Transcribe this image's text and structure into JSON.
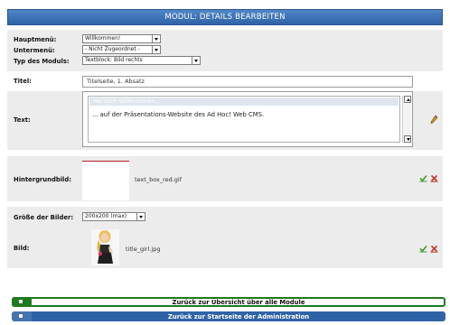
{
  "header": {
    "title": "MODUL: DETAILS BEARBEITEN"
  },
  "form": {
    "hauptmenu": {
      "label": "Hauptmenü:",
      "value": "Willkommen!"
    },
    "untermenu": {
      "label": "Untermenü:",
      "value": "- Nicht Zugeordnet -"
    },
    "typ": {
      "label": "Typ des Moduls:",
      "value": "Textblock: Bild rechts"
    },
    "titel": {
      "label": "Titel:",
      "value": "Titelseite, 1. Absatz"
    },
    "text": {
      "label": "Text:",
      "heading": "Herzlich Willkommen...",
      "body": "... auf der Präsentations-Website des Ad Hoc! Web CMS."
    },
    "hintergrundbild": {
      "label": "Hintergrundbild:",
      "file": "text_box_red.gif"
    },
    "groesse": {
      "label": "Größe der Bilder:",
      "value": "200x200 (max)"
    },
    "bild": {
      "label": "Bild:",
      "file": "title_girl.jpg"
    }
  },
  "nav": {
    "modules": "Zurück zur Übersicht über alle Module",
    "admin": "Zurück zur Startseite der Administration"
  },
  "colors": {
    "header": "#2f63a6",
    "nav_green": "#1f7a1f",
    "nav_blue": "#2f63a6",
    "accent_red": "#b22222"
  }
}
